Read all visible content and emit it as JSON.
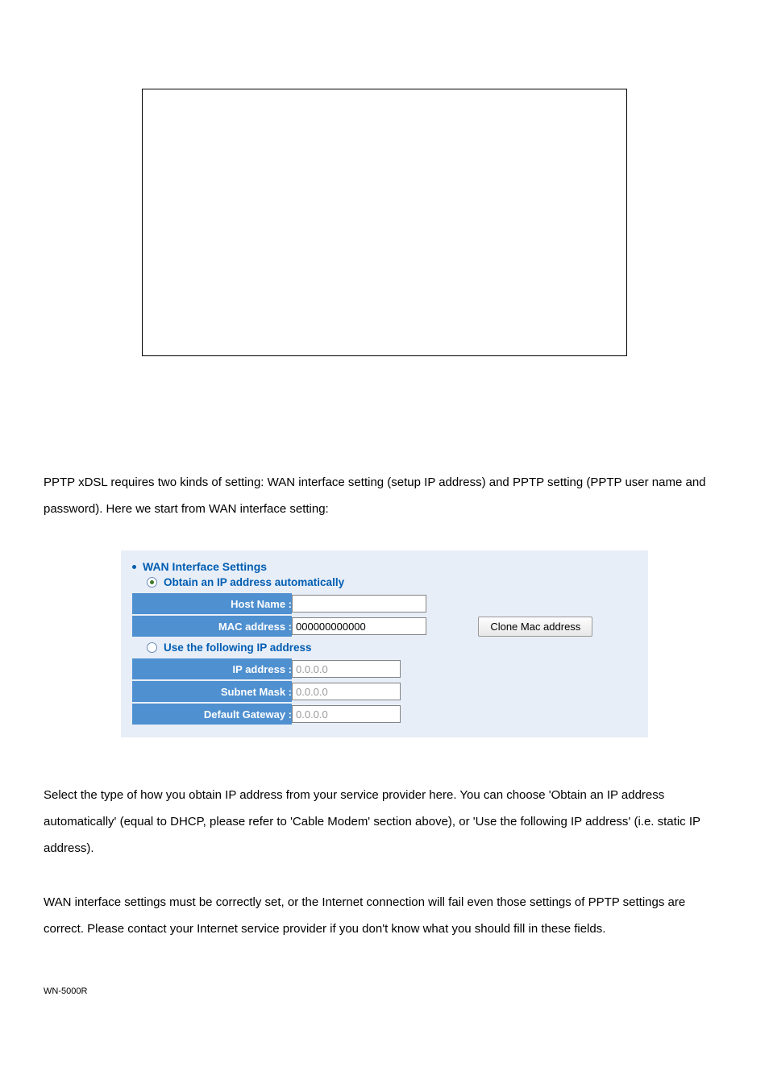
{
  "intro": "PPTP xDSL requires two kinds of setting: WAN interface setting (setup IP address) and PPTP setting (PPTP user name and password). Here we start from WAN interface setting:",
  "form": {
    "title": "WAN Interface Settings",
    "option1": "Obtain an IP address automatically",
    "option2": "Use the following IP address",
    "host_name_label": "Host Name :",
    "host_name_value": "",
    "mac_label": "MAC address :",
    "mac_value": "000000000000",
    "clone_btn": "Clone Mac address",
    "ip_label": "IP address :",
    "ip_value": "0.0.0.0",
    "subnet_label": "Subnet Mask :",
    "subnet_value": "0.0.0.0",
    "gateway_label": "Default Gateway :",
    "gateway_value": "0.0.0.0"
  },
  "para2": "Select the type of how you obtain IP address from your service provider here. You can choose 'Obtain an IP address automatically' (equal to DHCP, please refer to 'Cable Modem' section above), or 'Use the following IP address' (i.e. static IP address).",
  "para3": "WAN interface settings must be correctly set, or the Internet connection will fail even those settings of PPTP settings are correct. Please contact your Internet service provider if you don't know what you should fill in these fields.",
  "footer": "WN-5000R"
}
